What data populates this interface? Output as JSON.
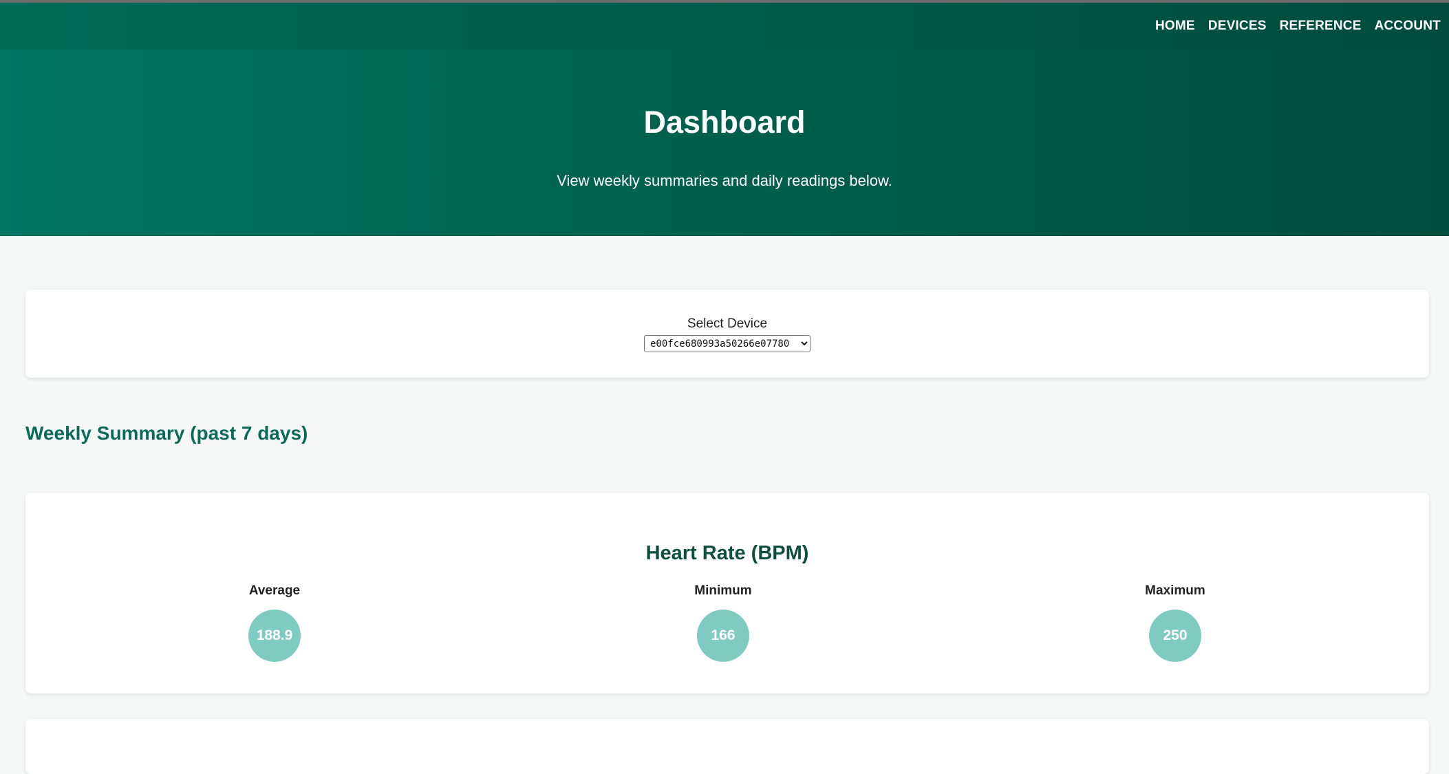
{
  "nav": {
    "items": [
      "HOME",
      "DEVICES",
      "REFERENCE",
      "ACCOUNT"
    ]
  },
  "hero": {
    "title": "Dashboard",
    "subtitle": "View weekly summaries and daily readings below."
  },
  "device": {
    "label": "Select Device",
    "selected": "e00fce680993a50266e07780"
  },
  "weekly": {
    "title": "Weekly Summary (past 7 days)",
    "heart_rate": {
      "title": "Heart Rate (BPM)",
      "average_label": "Average",
      "average_value": "188.9",
      "minimum_label": "Minimum",
      "minimum_value": "166",
      "maximum_label": "Maximum",
      "maximum_value": "250"
    }
  },
  "colors": {
    "header_green": "#005a48",
    "accent_teal": "#80cbc1",
    "section_title": "#0b6a58"
  }
}
